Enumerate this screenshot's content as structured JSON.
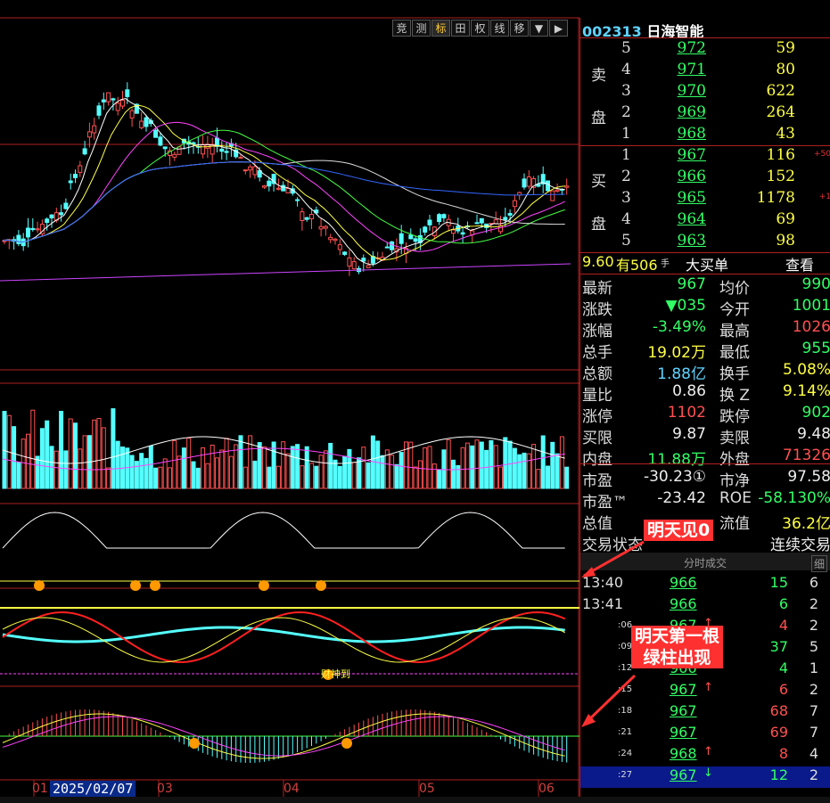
{
  "toolbar": {
    "buttons": [
      "竞",
      "测",
      "标",
      "田",
      "权",
      "线",
      "移",
      "▼",
      "▶"
    ]
  },
  "chart": {
    "date_cursor": "2025/02/07",
    "months": [
      "01",
      "03",
      "04",
      "05",
      "06"
    ],
    "annotation_macd": "财神到"
  },
  "stock": {
    "code": "002313",
    "name": "日海智能"
  },
  "order_book": {
    "sell_caption": [
      "卖",
      "盘"
    ],
    "buy_caption": [
      "买",
      "盘"
    ],
    "sell": [
      {
        "level": "5",
        "price": "972",
        "volume": "59"
      },
      {
        "level": "4",
        "price": "971",
        "volume": "80"
      },
      {
        "level": "3",
        "price": "970",
        "volume": "622"
      },
      {
        "level": "2",
        "price": "969",
        "volume": "264"
      },
      {
        "level": "1",
        "price": "968",
        "volume": "43"
      }
    ],
    "buy": [
      {
        "level": "1",
        "price": "967",
        "volume": "116"
      },
      {
        "level": "2",
        "price": "966",
        "volume": "152"
      },
      {
        "level": "3",
        "price": "965",
        "volume": "1178"
      },
      {
        "level": "4",
        "price": "964",
        "volume": "69"
      },
      {
        "level": "5",
        "price": "963",
        "volume": "98"
      }
    ],
    "side_marks": [
      "+50",
      "+1"
    ]
  },
  "big_order": {
    "price": "9.60",
    "text": "有506",
    "unit": "手",
    "label": "大买单",
    "view": "查看"
  },
  "stats": [
    {
      "k1": "最新",
      "v1": "967",
      "c1": "green",
      "k2": "均价",
      "v2": "990",
      "c2": "green"
    },
    {
      "k1": "涨跌",
      "v1": "▼035",
      "c1": "green",
      "k2": "今开",
      "v2": "1001",
      "c2": "green"
    },
    {
      "k1": "涨幅",
      "v1": "-3.49%",
      "c1": "green",
      "k2": "最高",
      "v2": "1026",
      "c2": "red"
    },
    {
      "k1": "总手",
      "v1": "19.02万",
      "c1": "yellow",
      "k2": "最低",
      "v2": "955",
      "c2": "green"
    },
    {
      "k1": "总额",
      "v1": "1.88亿",
      "c1": "cyan",
      "k2": "换手",
      "v2": "5.08%",
      "c2": "yellow"
    },
    {
      "k1": "量比",
      "v1": "0.86",
      "c1": "white",
      "k2": "换 Z",
      "v2": "9.14%",
      "c2": "yellow"
    },
    {
      "k1": "涨停",
      "v1": "1102",
      "c1": "red",
      "k2": "跌停",
      "v2": "902",
      "c2": "green"
    },
    {
      "k1": "买限",
      "v1": "9.87",
      "c1": "white",
      "k2": "卖限",
      "v2": "9.48",
      "c2": "white"
    },
    {
      "k1": "内盘",
      "v1": "11.88万",
      "c1": "green",
      "k2": "外盘",
      "v2": "71326",
      "c2": "red"
    },
    {
      "k1": "市盈",
      "v1": "-30.23①",
      "c1": "white",
      "k2": "市净",
      "v2": "97.58",
      "c2": "white"
    },
    {
      "k1": "市盈™",
      "v1": "-23.42",
      "c1": "white",
      "k2": "ROE",
      "v2": "-58.130%",
      "c2": "green"
    },
    {
      "k1": "总值",
      "v1": "",
      "c1": "white",
      "k2": "流值",
      "v2": "36.2亿",
      "c2": "yellow"
    },
    {
      "k1": "交易状态",
      "v1": "",
      "c1": "white",
      "k2": "",
      "v2": "连续交易",
      "c2": "white"
    }
  ],
  "trades": {
    "header": "分时成交",
    "detail": "细",
    "rows": [
      {
        "time": "13:40",
        "small": false,
        "price": "966",
        "arrow": "",
        "vol": "15",
        "vc": "green",
        "n": "6"
      },
      {
        "time": "13:41",
        "small": false,
        "price": "966",
        "arrow": "",
        "vol": "6",
        "vc": "green",
        "n": "2"
      },
      {
        "time": ":06",
        "small": true,
        "price": "967",
        "arrow": "↑",
        "vol": "4",
        "vc": "red",
        "n": "2"
      },
      {
        "time": ":09",
        "small": true,
        "price": "966",
        "arrow": "",
        "vol": "37",
        "vc": "green",
        "n": "5"
      },
      {
        "time": ":12",
        "small": true,
        "price": "966",
        "arrow": "",
        "vol": "4",
        "vc": "green",
        "n": "1"
      },
      {
        "time": ":15",
        "small": true,
        "price": "967",
        "arrow": "↑",
        "vol": "6",
        "vc": "red",
        "n": "2"
      },
      {
        "time": ":18",
        "small": true,
        "price": "967",
        "arrow": "",
        "vol": "68",
        "vc": "red",
        "n": "7"
      },
      {
        "time": ":21",
        "small": true,
        "price": "967",
        "arrow": "",
        "vol": "69",
        "vc": "red",
        "n": "7"
      },
      {
        "time": ":24",
        "small": true,
        "price": "968",
        "arrow": "↑",
        "vol": "8",
        "vc": "red",
        "n": "4"
      },
      {
        "time": ":27",
        "small": true,
        "price": "967",
        "arrow": "↓",
        "vol": "12",
        "vc": "green",
        "n": "2"
      }
    ]
  },
  "callouts": {
    "zero_text": "明天见0",
    "green_text": "明天第一根\n绿柱出现"
  },
  "colors": {
    "up": "#ff5050",
    "down": "#55ffff",
    "border": "#b02020",
    "accent": "#5fd3ff"
  }
}
